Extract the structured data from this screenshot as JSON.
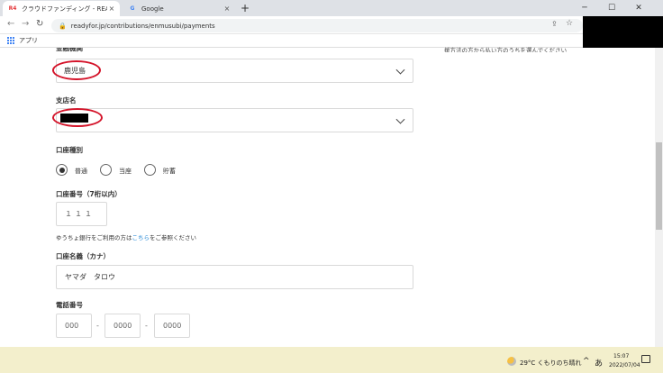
{
  "browser": {
    "tabs": [
      {
        "title": "クラウドファンディング - READYFOR",
        "favicon": "R4",
        "close": "×"
      },
      {
        "title": "Google",
        "favicon": "G",
        "close": "×"
      }
    ],
    "new_tab": "+",
    "window_controls": {
      "minimize": "─",
      "maximize": "☐",
      "close": "✕"
    },
    "url": "readyfor.jp/contributions/enmusubi/payments",
    "bookmarks": {
      "apps_label": "アプリ"
    }
  },
  "form": {
    "bank_label": "金融機関",
    "bank_value": "鹿児島",
    "branch_label": "支店名",
    "account_type_label": "口座種別",
    "account_types": [
      {
        "label": "普通",
        "checked": true
      },
      {
        "label": "当座",
        "checked": false
      },
      {
        "label": "貯蓄",
        "checked": false
      }
    ],
    "account_number_label": "口座番号（7桁以内）",
    "account_number_value": "１１１",
    "yucho_note_pre": "ゆうちょ銀行をご利用の方は",
    "yucho_note_link": "こちら",
    "yucho_note_post": "をご参照ください",
    "account_name_label": "口座名義（カナ）",
    "account_name_value": "ヤマダ　タロウ",
    "phone_label": "電話番号",
    "phone_placeholders": [
      "000",
      "0000",
      "0000"
    ],
    "phone_dash": "-",
    "side_note": "援方法の方から払い方のうちを選んでください"
  },
  "taskbar": {
    "weather": "29°C くもりのち晴れ",
    "ime": "あ",
    "time": "15:07",
    "date": "2022/07/04",
    "tray_arrow": "^"
  },
  "colors": {
    "annotation": "#d4142a",
    "link": "#2b8bd6",
    "taskbar": "#f3efcc"
  }
}
